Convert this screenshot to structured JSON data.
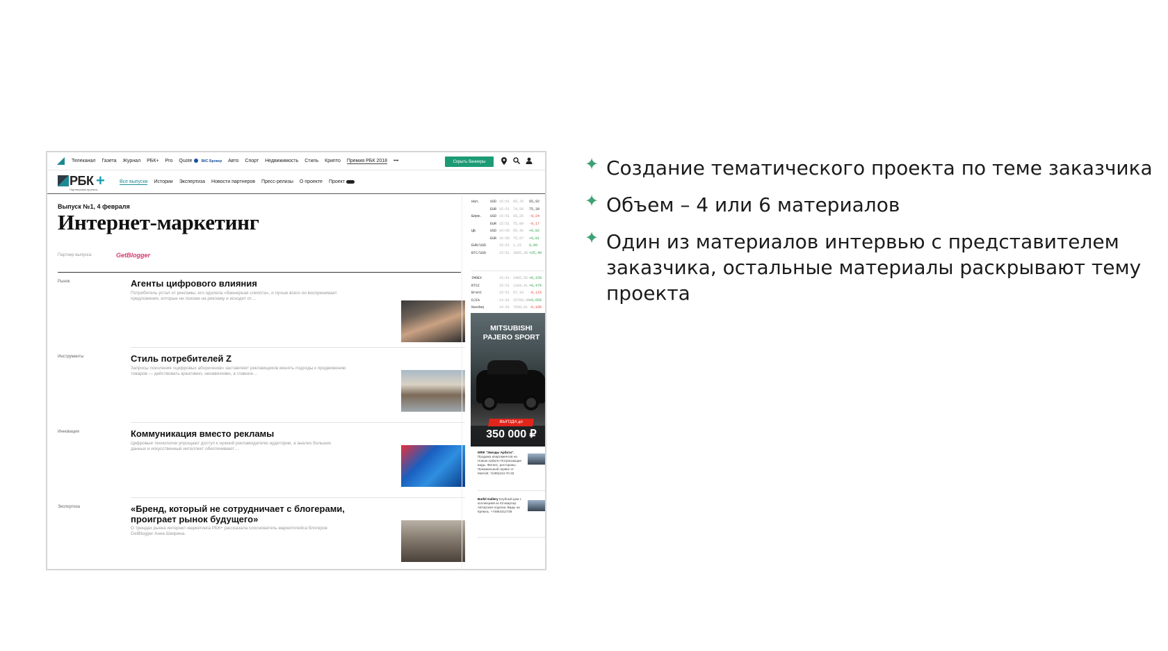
{
  "nav": {
    "items": [
      "Телеканал",
      "Газета",
      "Журнал",
      "РБК+",
      "Pro",
      "Quote"
    ],
    "quote_partner": "ВКС Брокер",
    "items2": [
      "Авто",
      "Спорт",
      "Недвижимость",
      "Стиль",
      "Крипто"
    ],
    "premia": "Премия РБК 2018",
    "more": "•••",
    "hide_banners": "Скрыть баннеры"
  },
  "header": {
    "logo": "РБК",
    "logo_plus": "+",
    "logo_sub": "Партнерские проекты",
    "tabs": [
      "Все выпуски",
      "Истории",
      "Экспертиза",
      "Новости партнеров",
      "Пресс-релизы",
      "О проекте",
      "Проект"
    ]
  },
  "issue": {
    "label": "Выпуск №1, 4 февраля",
    "title": "Интернет-маркетинг",
    "partner_label": "Партнер выпуска:",
    "partner": "GetBlogger"
  },
  "articles": [
    {
      "rubric": "Рынок",
      "title": "Агенты цифрового влияния",
      "lead": "Потребитель устал от рекламы, его одолела «баннерная слепота», и лучше всего он воспринимает предложения, которые не похожи на рекламу и исходят от…"
    },
    {
      "rubric": "Инструменты",
      "title": "Стиль потребителей Z",
      "lead": "Запросы поколения «цифровых аборигенов» заставляют рекламщиков менять подходы к продвижению товаров — действовать креативно, ненавязчиво, а главное…"
    },
    {
      "rubric": "Инновации",
      "title": "Коммуникация вместо рекламы",
      "lead": "Цифровые технологии упрощают доступ к нужной рекламодателю аудитории, а анализ больших данных и искусственный интеллект обеспечивают…"
    },
    {
      "rubric": "Экспертиза",
      "title": "«Бренд, который не сотрудничает с блогерами, проиграет рынок будущего»",
      "lead": "О трендах рынка интернет-маркетинга РБК+ рассказала сооснователь маркетплейса блогеров GetBlogger Анна Шкирина."
    }
  ],
  "rates": [
    {
      "name": "Нал.",
      "cur": "USD",
      "time": "15:51",
      "value": "65,76",
      "delta": "65,92",
      "dir": ""
    },
    {
      "name": "",
      "cur": "EUR",
      "time": "15:51",
      "value": "74,50",
      "delta": "75,39",
      "dir": ""
    },
    {
      "name": "Бирж.",
      "cur": "USD",
      "time": "15:51",
      "value": "65,26",
      "delta": "-0,24",
      "dir": "dn"
    },
    {
      "name": "",
      "cur": "EUR",
      "time": "15:51",
      "value": "75,09",
      "delta": "-0,17",
      "dir": "dn"
    },
    {
      "name": "ЦБ",
      "cur": "USD",
      "time": "16:05",
      "value": "65,42",
      "delta": "+0,02",
      "dir": "up"
    },
    {
      "name": "",
      "cur": "EUR",
      "time": "16:05",
      "value": "75,07",
      "delta": "+0,01",
      "dir": "up"
    },
    {
      "name": "EUR/USD",
      "cur": "",
      "time": "15:51",
      "value": "1,15",
      "delta": "0,00",
      "dir": "up"
    },
    {
      "name": "BTC/USD",
      "cur": "",
      "time": "15:51",
      "value": "3965,38",
      "delta": "+25,40",
      "dir": "up"
    },
    {
      "name": "IMOEX",
      "cur": "",
      "time": "15:51",
      "value": "2465,55",
      "delta": "+0,15%",
      "dir": "up"
    },
    {
      "name": "RTSI",
      "cur": "",
      "time": "15:51",
      "value": "1184,41",
      "delta": "+0,47%",
      "dir": "up"
    },
    {
      "name": "Brent",
      "cur": "",
      "time": "15:51",
      "value": "67,18",
      "delta": "-0,11%",
      "dir": "dn"
    },
    {
      "name": "DJIA",
      "cur": "",
      "time": "14.01",
      "value": "25789,99",
      "delta": "+0,65%",
      "dir": "up"
    },
    {
      "name": "Nasdaq",
      "cur": "",
      "time": "14.01",
      "value": "7658,91",
      "delta": "-0,10%",
      "dir": "dn"
    }
  ],
  "ad": {
    "brand_line1": "MITSUBISHI",
    "brand_line2": "PAJERO SPORT",
    "badge": "ВЫГОДА до",
    "price": "350 000 ₽"
  },
  "promos": [
    {
      "title": "МФК \"Звезды Арбата\".",
      "text": "Продажа апартаментов на Новом Арбате! Потрясающие виды. Фитнес, рестораны. Премиальный сервис от Marriott. 7(495)154-70-33"
    },
    {
      "title": "Barkli Gallery",
      "text": "Клубный дом с коллекцией из 43 квартир. Авторская отделка. Виды на Кремль. +74954312738"
    }
  ],
  "bullets": [
    "Создание тематического проекта по теме заказчика",
    "Объем – 4 или 6 материалов",
    "Один из материалов интервью с представителем заказчика, остальные материалы раскрывают тему проекта"
  ],
  "colors": {
    "accent": "#3fa173",
    "rbc_teal": "#1a8a93",
    "hide_button": "#1d9b74"
  }
}
